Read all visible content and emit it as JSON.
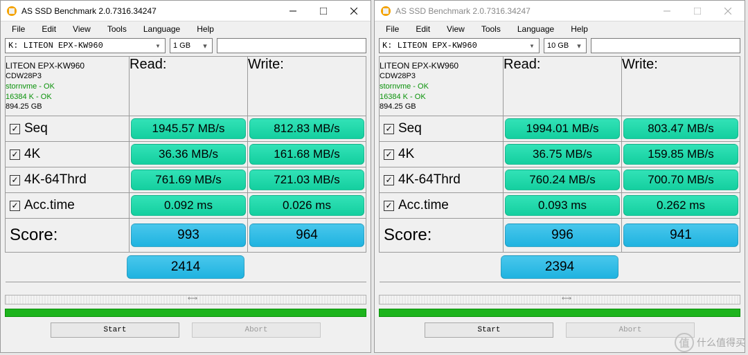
{
  "app_title": "AS SSD Benchmark 2.0.7316.34247",
  "menu": {
    "file": "File",
    "edit": "Edit",
    "view": "View",
    "tools": "Tools",
    "language": "Language",
    "help": "Help"
  },
  "buttons": {
    "start": "Start",
    "abort": "Abort"
  },
  "headers": {
    "read": "Read:",
    "write": "Write:"
  },
  "row_labels": {
    "seq": "Seq",
    "fk": "4K",
    "fk64": "4K-64Thrd",
    "acc": "Acc.time",
    "score": "Score:"
  },
  "drive_label": "K: LITEON EPX-KW960",
  "info": {
    "model": "LITEON EPX-KW960",
    "fw": "CDW28P3",
    "driver": "stornvme - OK",
    "align": "16384 K - OK",
    "size": "894.25 GB"
  },
  "watermark": {
    "char": "值",
    "text": "什么值得买"
  },
  "windows": [
    {
      "active": true,
      "test_size": "1 GB",
      "results": {
        "seq": {
          "read": "1945.57 MB/s",
          "write": "812.83 MB/s"
        },
        "fk": {
          "read": "36.36 MB/s",
          "write": "161.68 MB/s"
        },
        "fk64": {
          "read": "761.69 MB/s",
          "write": "721.03 MB/s"
        },
        "acc": {
          "read": "0.092 ms",
          "write": "0.026 ms"
        }
      },
      "score": {
        "read": "993",
        "write": "964",
        "total": "2414"
      }
    },
    {
      "active": false,
      "test_size": "10 GB",
      "results": {
        "seq": {
          "read": "1994.01 MB/s",
          "write": "803.47 MB/s"
        },
        "fk": {
          "read": "36.75 MB/s",
          "write": "159.85 MB/s"
        },
        "fk64": {
          "read": "760.24 MB/s",
          "write": "700.70 MB/s"
        },
        "acc": {
          "read": "0.093 ms",
          "write": "0.262 ms"
        }
      },
      "score": {
        "read": "996",
        "write": "941",
        "total": "2394"
      }
    }
  ]
}
